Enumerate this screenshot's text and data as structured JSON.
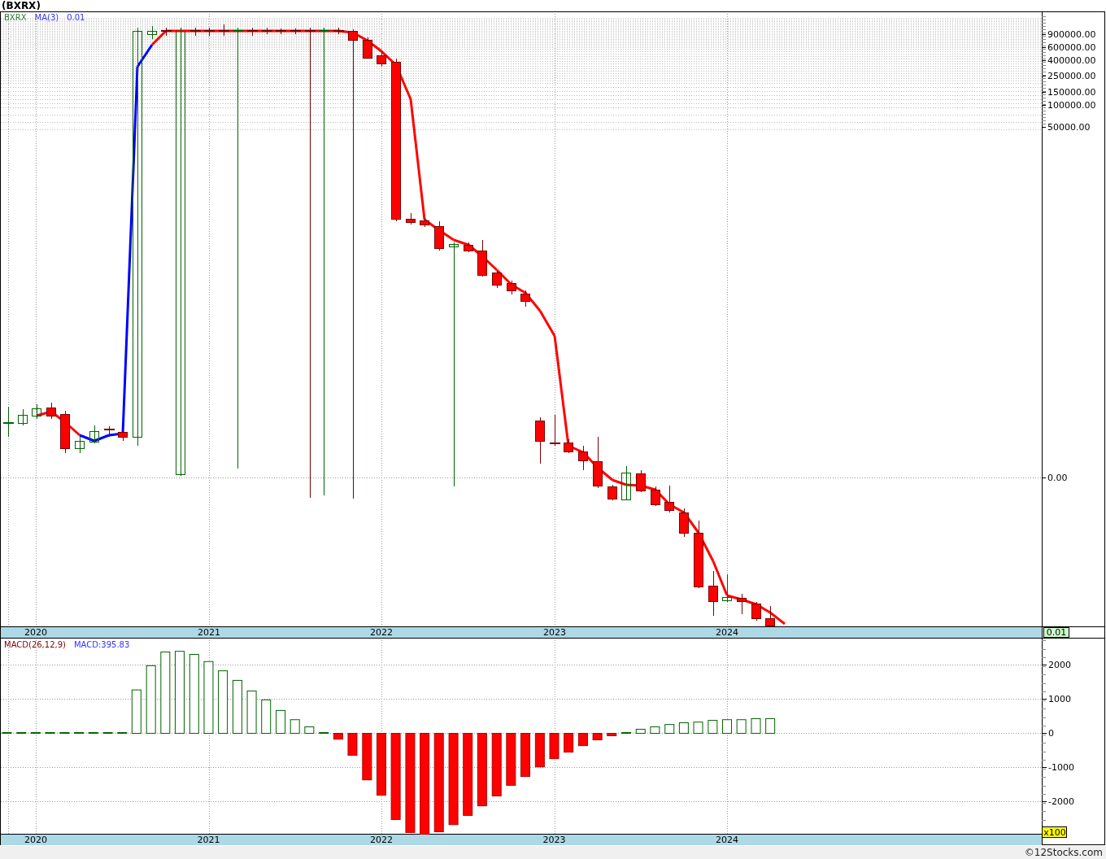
{
  "title": "(BXRX)",
  "price_chart": {
    "legend": [
      {
        "kind": "symbol",
        "text": "BXRX"
      },
      {
        "kind": "indicator",
        "text": "MA(3)"
      },
      {
        "kind": "value",
        "text": "0.01"
      }
    ],
    "y_labels": [
      "900000.00",
      "600000.00",
      "400000.00",
      "250000.00",
      "150000.00",
      "100000.00",
      "50000.00",
      "0.00"
    ],
    "x_labels": [
      "2020",
      "2021",
      "2022",
      "2023",
      "2024"
    ],
    "last_value": "0.01"
  },
  "macd_panel": {
    "legend": [
      {
        "kind": "indicator",
        "text": "MACD(26,12,9)"
      },
      {
        "kind": "value",
        "text": "MACD:395.83"
      }
    ],
    "multiplier": "x100",
    "chart_data": {
      "type": "bar",
      "x": [
        2019.833,
        2019.917,
        2020,
        2020.083,
        2020.167,
        2020.25,
        2020.333,
        2020.417,
        2020.5,
        2020.583,
        2020.667,
        2020.75,
        2020.833,
        2020.917,
        2021,
        2021.083,
        2021.167,
        2021.25,
        2021.333,
        2021.417,
        2021.5,
        2021.583,
        2021.667,
        2021.75,
        2021.833,
        2021.917,
        2022,
        2022.083,
        2022.167,
        2022.25,
        2022.333,
        2022.417,
        2022.5,
        2022.583,
        2022.667,
        2022.75,
        2022.833,
        2022.917,
        2023,
        2023.083,
        2023.167,
        2023.25,
        2023.333,
        2023.417,
        2023.5,
        2023.583,
        2023.667,
        2023.75,
        2023.833,
        2023.917,
        2024,
        2024.083,
        2024.167,
        2024.25
      ],
      "series": [
        {
          "color": "#006400",
          "values": [
            0,
            0,
            0,
            0,
            0,
            0,
            0,
            0,
            0,
            1270,
            1980,
            2380,
            2400,
            2310,
            2100,
            1830,
            1550,
            1240,
            980,
            670,
            400,
            190,
            0,
            null,
            null,
            null,
            null,
            null,
            null,
            null,
            null,
            null,
            null,
            null,
            null,
            null,
            null,
            null,
            null,
            null,
            null,
            null,
            null,
            20,
            120,
            190,
            260,
            310,
            330,
            380,
            400,
            400,
            430,
            430
          ]
        },
        {
          "color": "#ff0000",
          "values": [
            null,
            null,
            null,
            null,
            null,
            null,
            null,
            null,
            null,
            null,
            null,
            null,
            null,
            null,
            null,
            null,
            null,
            null,
            null,
            null,
            null,
            null,
            null,
            -170,
            -640,
            -1360,
            -1810,
            -2520,
            -2900,
            -2950,
            -2880,
            -2670,
            -2400,
            -2120,
            -1830,
            -1520,
            -1260,
            -980,
            -740,
            -550,
            -360,
            -190,
            -70,
            null,
            null,
            null,
            null,
            null,
            null,
            null,
            null,
            null,
            null,
            null
          ]
        }
      ],
      "stacked": true,
      "grid": true,
      "xticks": [
        2020,
        2021,
        2022,
        2023,
        2024
      ],
      "xlim": [
        2019.798,
        2025.821
      ],
      "yticks": [
        {
          "value": -2000,
          "label": "-2000"
        },
        {
          "value": -1000,
          "label": "-1000"
        },
        {
          "value": 0,
          "label": "0"
        },
        {
          "value": 1000,
          "label": "1000"
        },
        {
          "value": 2000,
          "label": "2000"
        }
      ],
      "ylim": [
        -2950,
        2714
      ]
    }
  },
  "footer": "©12Stocks.com"
}
